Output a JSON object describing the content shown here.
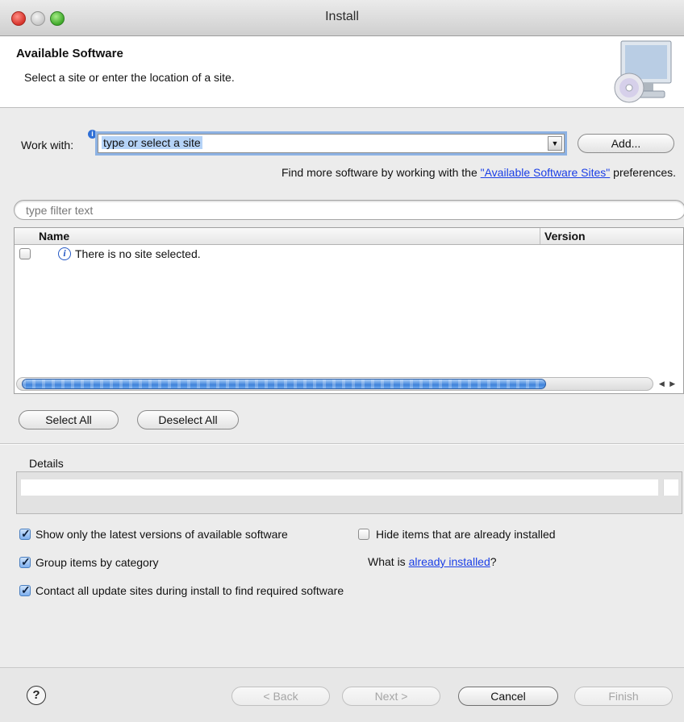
{
  "window": {
    "title": "Install"
  },
  "header": {
    "title": "Available Software",
    "description": "Select a site or enter the location of a site.",
    "icon": "monitor-cd-icon"
  },
  "work_with": {
    "label": "Work with:",
    "info_icon": "info-icon",
    "value": "type or select a site",
    "add_label": "Add..."
  },
  "find_more": {
    "prefix": "Find more software by working with the ",
    "link": "\"Available Software Sites\"",
    "suffix": " preferences."
  },
  "filter": {
    "placeholder": "type filter text"
  },
  "table": {
    "columns": [
      "Name",
      "Version"
    ],
    "rows": [
      {
        "checked": false,
        "icon": "info-icon",
        "name": "There is no site selected."
      }
    ]
  },
  "selection_buttons": {
    "select_all": "Select All",
    "deselect_all": "Deselect All"
  },
  "details": {
    "label": "Details"
  },
  "options": {
    "show_latest": {
      "label": "Show only the latest versions of available software",
      "checked": true
    },
    "hide_installed": {
      "label": "Hide items that are already installed",
      "checked": false
    },
    "group_by_category": {
      "label": "Group items by category",
      "checked": true
    },
    "what_is": {
      "prefix": "What is ",
      "link": "already installed",
      "suffix": "?"
    },
    "contact_all": {
      "label": "Contact all update sites during install to find required software",
      "checked": true
    }
  },
  "footer": {
    "help_icon": "help-icon",
    "back": "< Back",
    "next": "Next >",
    "cancel": "Cancel",
    "finish": "Finish"
  },
  "colors": {
    "accent": "#3e82da",
    "link": "#1a3ee6",
    "selection": "#b5d3f7"
  }
}
